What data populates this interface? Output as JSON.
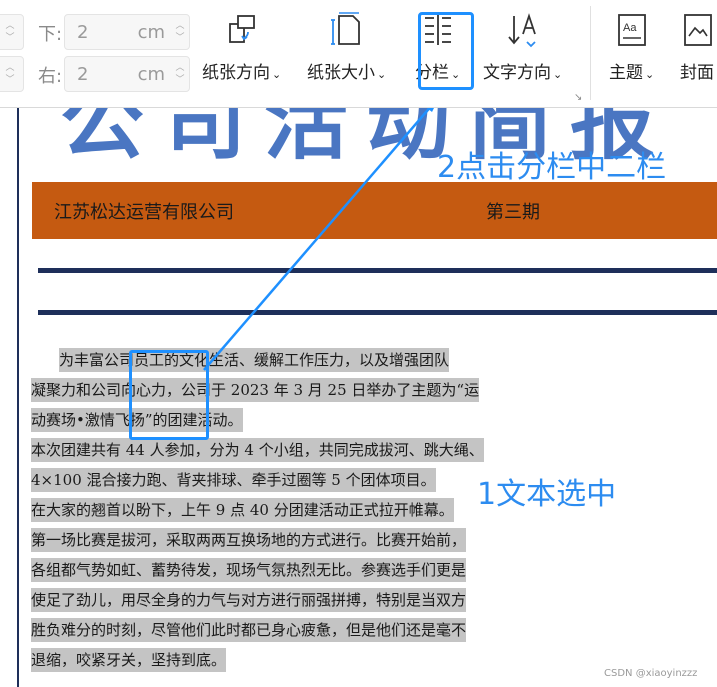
{
  "ribbon": {
    "margin_bottom": {
      "label": "下:",
      "value": "2",
      "unit": "cm"
    },
    "margin_right": {
      "label": "右:",
      "value": "2",
      "unit": "cm"
    },
    "tools": [
      {
        "label": "纸张方向",
        "icon": "page-orientation-icon"
      },
      {
        "label": "纸张大小",
        "icon": "page-size-icon"
      },
      {
        "label": "分栏",
        "icon": "columns-icon"
      },
      {
        "label": "文字方向",
        "icon": "text-direction-icon"
      },
      {
        "label": "主题",
        "icon": "theme-icon"
      },
      {
        "label": "封面",
        "icon": "cover-icon"
      }
    ],
    "chevron": "⌄"
  },
  "document": {
    "banner_company": "江苏松达运营有限公司",
    "banner_issue": "第三期",
    "paragraphs": [
      "为丰富公司员工的文化生活、缓解工作压力，以及增强团队",
      "凝聚力和公司向心力，公司于 2023 年 3 月 25 日举办了主题为“运",
      "动赛场•激情飞扬”的团建活动。",
      "本次团建共有 44 人参加，分为 4 个小组，共同完成拔河、跳大绳、",
      "4×100 混合接力跑、背夹排球、牵手过圈等 5 个团体项目。",
      "在大家的翘首以盼下，上午 9 点 40 分团建活动正式拉开帷幕。",
      "第一场比赛是拔河，采取两两互换场地的方式进行。比赛开始前，",
      "各组都气势如虹、蓄势待发，现场气氛热烈无比。参赛选手们更是",
      "使足了劲儿，用尽全身的力气与对方进行丽强拼搏，特别是当双方",
      "胜负难分的时刻，尽管他们此时都已身心疲惫，但是他们还是毫不",
      "退缩，咬紧牙关，坚持到底。"
    ]
  },
  "annotations": {
    "step2": "2点击分栏中二栏",
    "step1": "1文本选中",
    "accent_color": "#1e90ff"
  },
  "watermark": "CSDN @xiaoyinzzz"
}
